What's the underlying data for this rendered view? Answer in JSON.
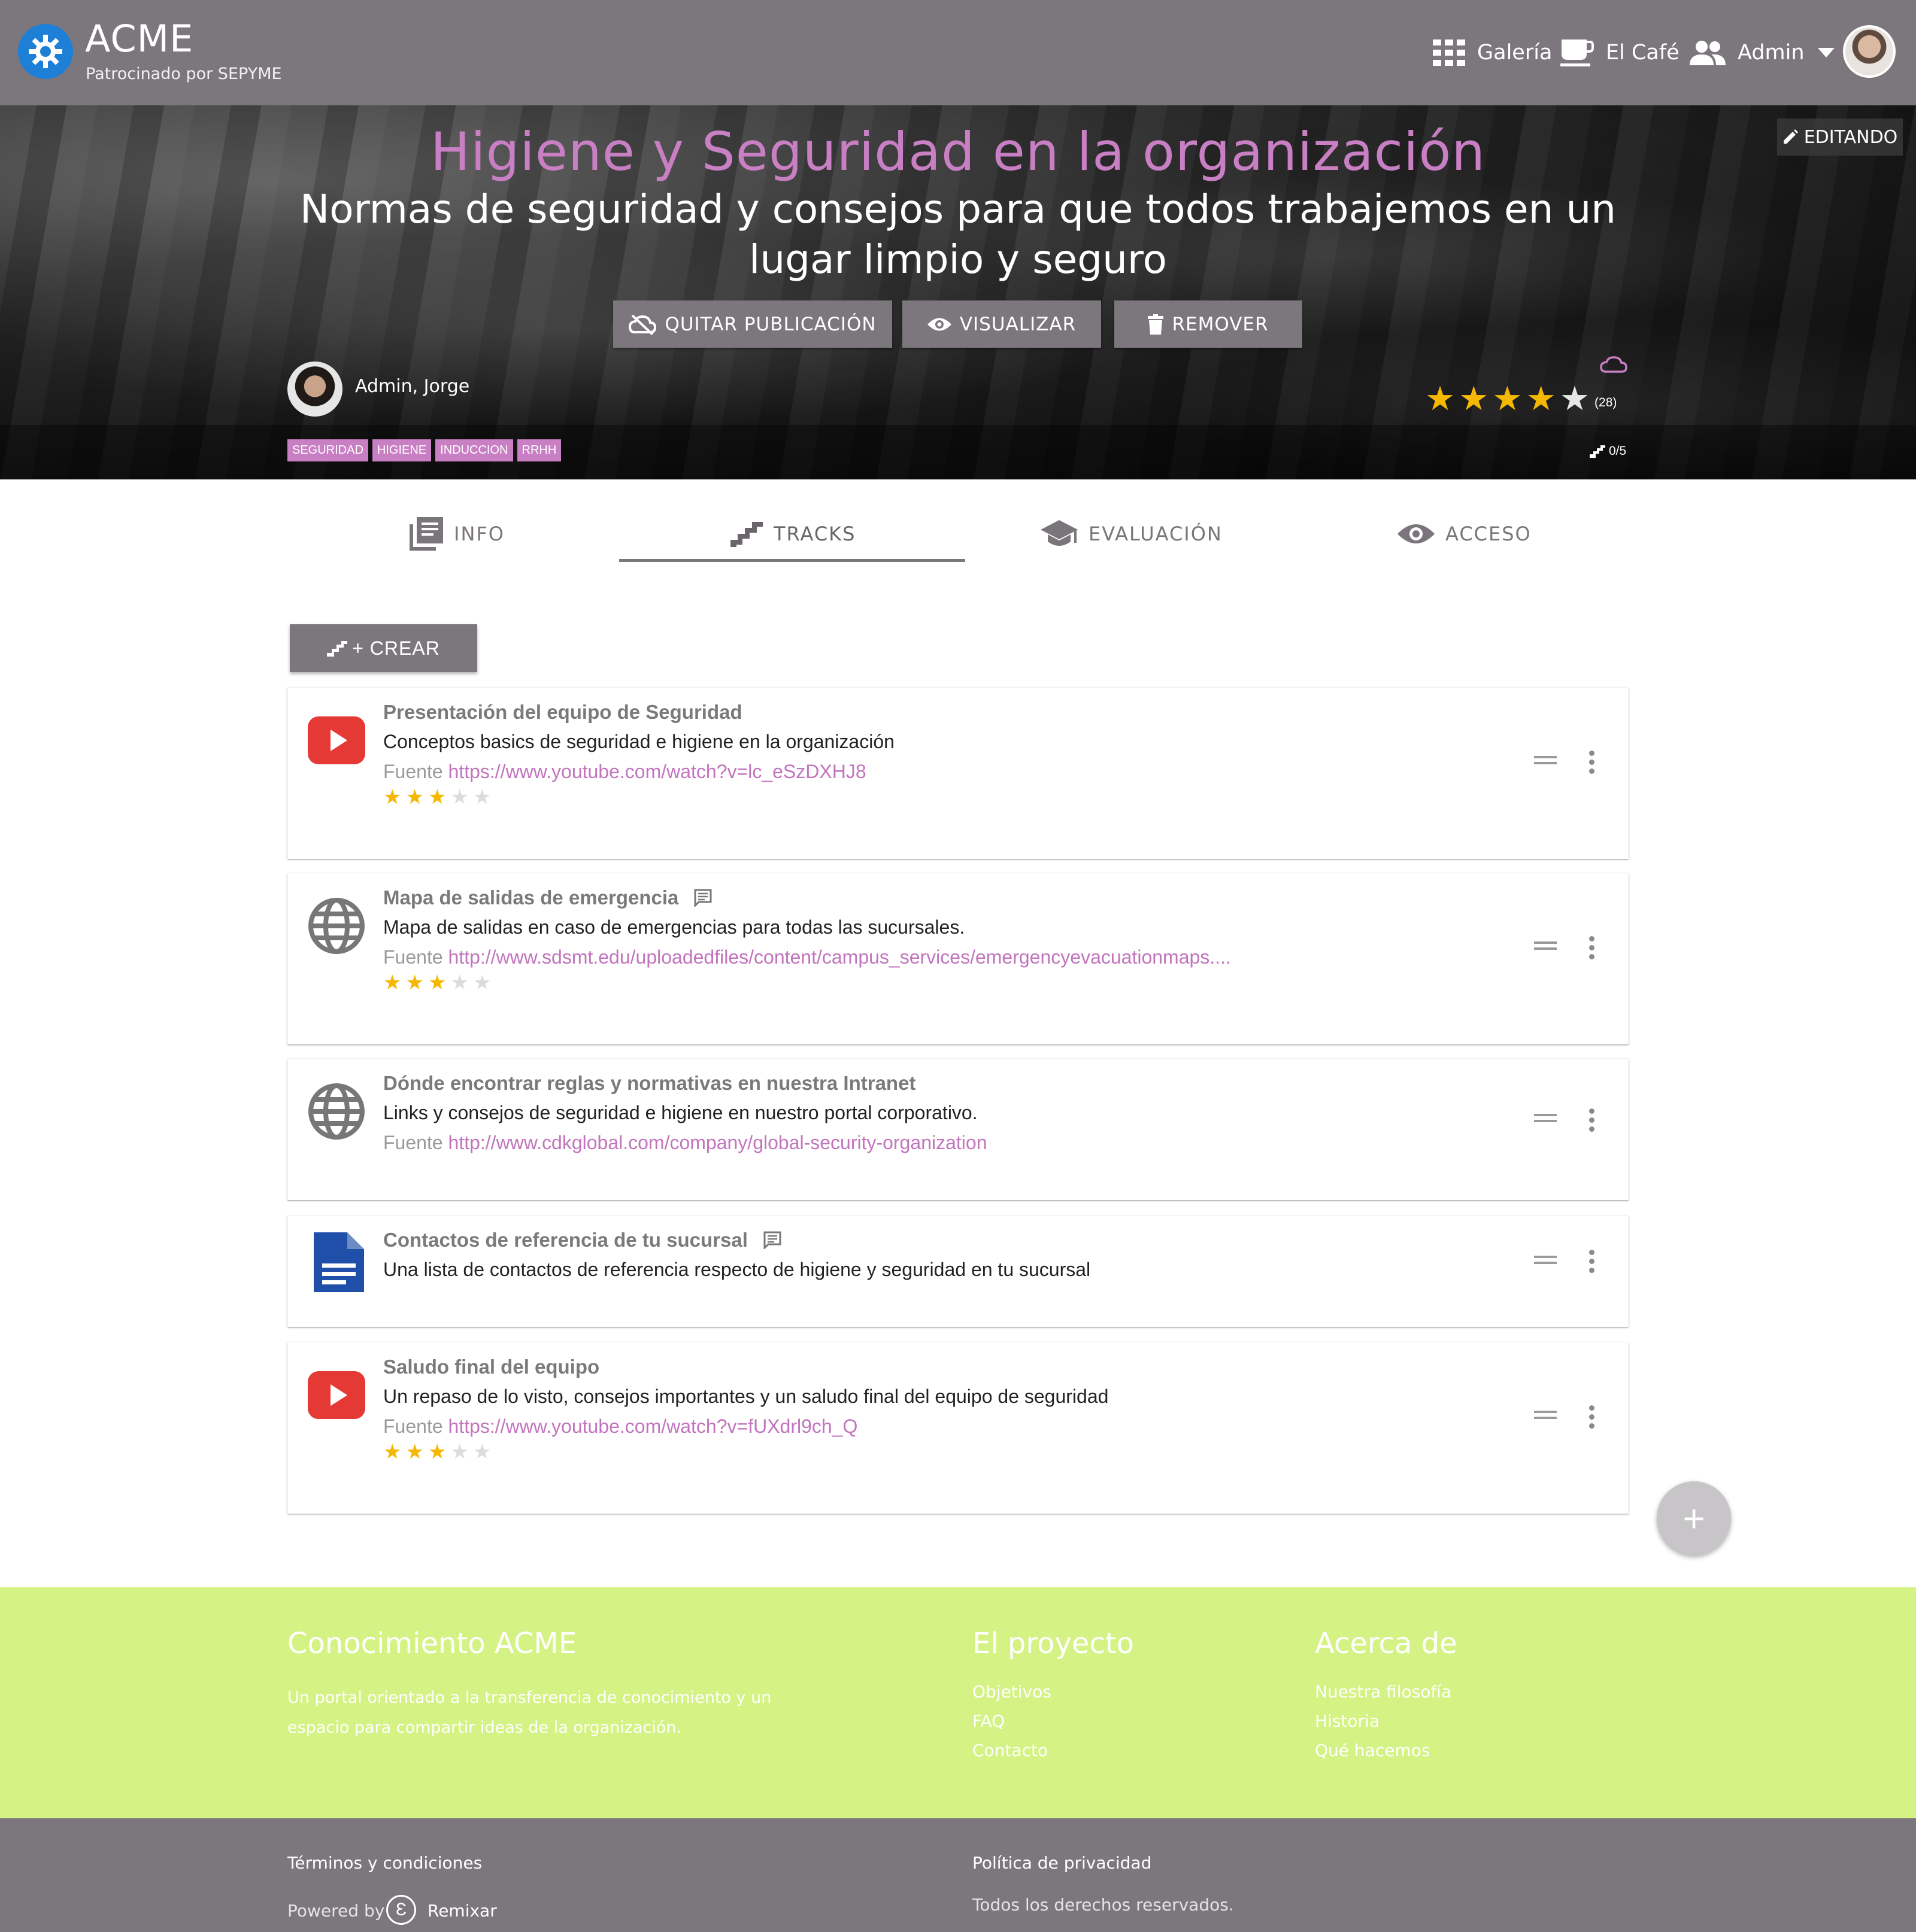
{
  "navbar": {
    "brand": "ACME",
    "sponsor": "Patrocinado por SEPYME",
    "links": [
      {
        "label": "Galería",
        "icon": "grid-icon"
      },
      {
        "label": "El Café",
        "icon": "coffee-icon"
      },
      {
        "label": "Admin",
        "icon": "people-icon"
      }
    ]
  },
  "hero": {
    "edit_badge": "EDITANDO",
    "title": "Higiene y Seguridad en la organización",
    "subtitle": "Normas de seguridad y consejos para que todos trabajemos en un lugar limpio y seguro",
    "buttons": {
      "unpublish": "QUITAR PUBLICACIÓN",
      "preview": "VISUALIZAR",
      "remove": "REMOVER"
    },
    "author": "Admin, Jorge",
    "tags": [
      "SEGURIDAD",
      "HIGIENE",
      "INDUCCION",
      "RRHH"
    ],
    "rating": 4,
    "rating_max": 5,
    "votes": "(28)",
    "progress": "0/5"
  },
  "tabs": [
    {
      "label": "INFO",
      "icon": "library-icon"
    },
    {
      "label": "TRACKS",
      "icon": "stairs-icon",
      "active": true
    },
    {
      "label": "EVALUACIÓN",
      "icon": "graduation-cap-icon"
    },
    {
      "label": "ACCESO",
      "icon": "eye-icon"
    }
  ],
  "create_button": "+ CREAR",
  "source_label": "Fuente",
  "tracks": [
    {
      "type": "youtube",
      "title": "Presentación del equipo de Seguridad",
      "description": "Conceptos basics de seguridad e higiene en la organización",
      "source": "https://www.youtube.com/watch?v=lc_eSzDXHJ8",
      "rating": 3
    },
    {
      "type": "web",
      "title": "Mapa de salidas de emergencia",
      "has_comment": true,
      "description": "Mapa de salidas en caso de emergencias para todas las sucursales.",
      "source": "http://www.sdsmt.edu/uploadedfiles/content/campus_services/emergencyevacuationmaps....",
      "rating": 3
    },
    {
      "type": "web",
      "title": "Dónde encontrar reglas y normativas en nuestra Intranet",
      "description": "Links y consejos de seguridad e higiene en nuestro portal corporativo.",
      "source": "http://www.cdkglobal.com/company/global-security-organization"
    },
    {
      "type": "document",
      "title": "Contactos de referencia de tu sucursal",
      "has_comment": true,
      "description": "Una lista de contactos de referencia respecto de higiene y seguridad en tu sucursal"
    },
    {
      "type": "youtube",
      "title": "Saludo final del equipo",
      "description": "Un repaso de lo visto, consejos importantes y un saludo final del equipo de seguridad",
      "source": "https://www.youtube.com/watch?v=fUXdrl9ch_Q",
      "rating": 3
    }
  ],
  "fab": "+",
  "footer": {
    "col1_title": "Conocimiento ACME",
    "col1_text": "Un portal orientado a la transferencia de conocimiento y un espacio para compartir ideas de la organización.",
    "col2_title": "El proyecto",
    "col2_links": [
      "Objetivos",
      "FAQ",
      "Contacto"
    ],
    "col3_title": "Acerca de",
    "col3_links": [
      "Nuestra filosofía",
      "Historia",
      "Qué hacemos"
    ]
  },
  "subfooter": {
    "terms": "Términos y condiciones",
    "powered_by": "Powered by",
    "remixar": "Remixar",
    "privacy": "Política de privacidad",
    "rights": "Todos los derechos reservados."
  },
  "colors": {
    "navbar": "#7c777c",
    "accent": "#c97fc3",
    "footer": "#d5f285",
    "star": "#f5b800",
    "youtube": "#e53935",
    "doc": "#1f4fa8"
  }
}
